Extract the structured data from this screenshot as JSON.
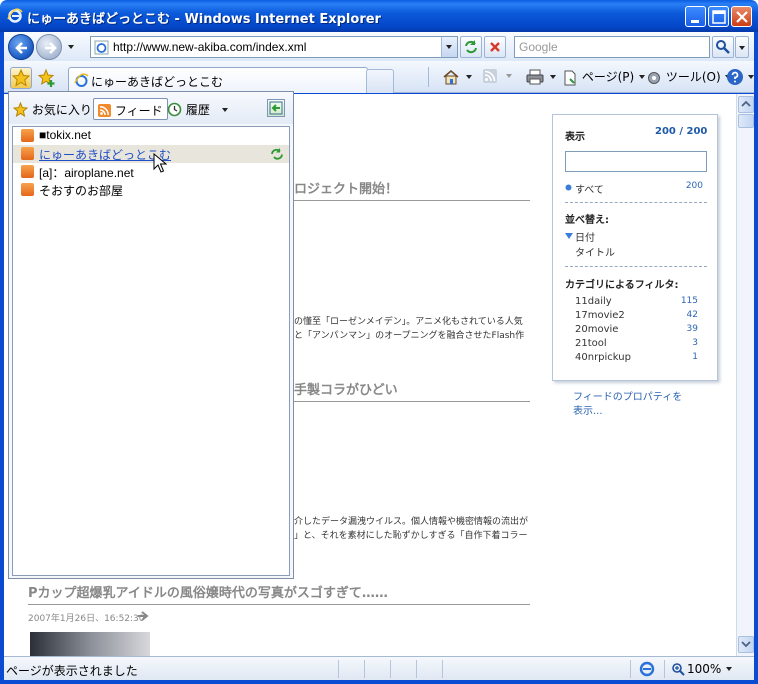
{
  "window": {
    "title": "にゅーあきばどっとこむ - Windows Internet Explorer"
  },
  "address_bar": {
    "url": "http://www.new-akiba.com/index.xml",
    "search_placeholder": "Google"
  },
  "tab": {
    "label": "にゅーあきばどっとこむ"
  },
  "command_bar": {
    "page_label": "ページ(P)",
    "tools_label": "ツール(O)"
  },
  "favorites_center": {
    "tabs": {
      "favorites": "お気に入り",
      "feeds": "フィード",
      "history": "履歴"
    },
    "feeds": [
      "■tokix.net",
      "にゅーあきばどっとこむ",
      "[a]：airoplane.net",
      "そおすのお部屋"
    ]
  },
  "page": {
    "articles": [
      {
        "title": "ロジェクト開始！"
      },
      {
        "title": "手製コラがひどい"
      },
      {
        "title": "Pカップ超爆乳アイドルの風俗嬢時代の写真がスゴすぎて……",
        "date": "2007年1月26日、16:52:30"
      }
    ],
    "snippets": [
      "の懂至「ローゼンメイデン」。アニメ化もされている人気",
      "と「アンパンマン」のオープニングを融合させたFlash作",
      "介したデータ漏洩ウイルス。個人情報や機密情報の流出が",
      "」と、それを素材にした恥ずかしすぎる「自作下着コラー"
    ],
    "filter_panel": {
      "display_label": "表示",
      "count": "200 / 200",
      "all_label": "すべて",
      "all_count": "200",
      "sort_label": "並べ替え:",
      "sort_date": "日付",
      "sort_title": "タイトル",
      "category_label": "カテゴリによるフィルタ:",
      "categories": [
        {
          "name": "11daily",
          "count": "115"
        },
        {
          "name": "17movie2",
          "count": "42"
        },
        {
          "name": "20movie",
          "count": "39"
        },
        {
          "name": "21tool",
          "count": "3"
        },
        {
          "name": "40nrpickup",
          "count": "1"
        }
      ]
    },
    "feed_properties_link": "フィードのプロパティを表示..."
  },
  "status_bar": {
    "text": "ページが表示されました",
    "zoom": "100%"
  }
}
